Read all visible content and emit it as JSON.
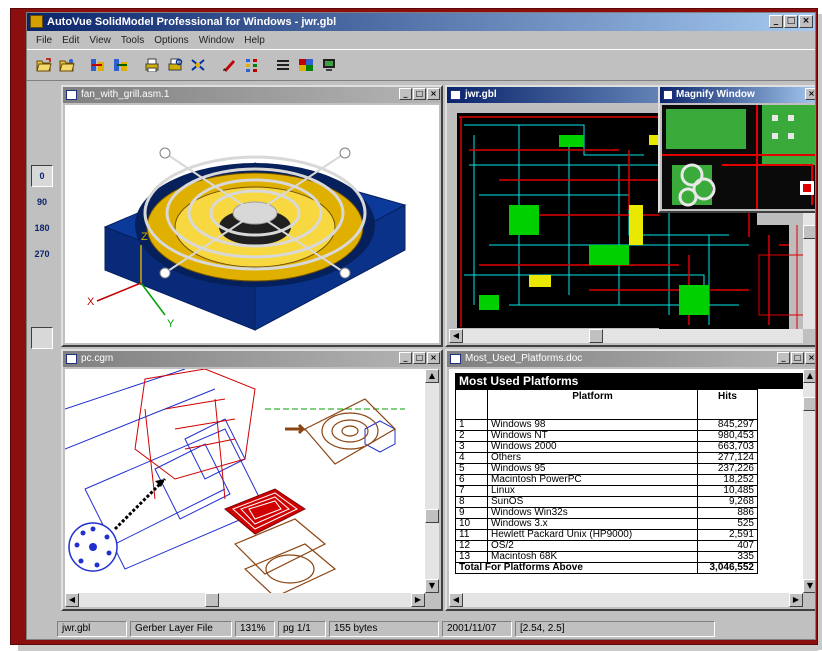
{
  "app": {
    "title": "AutoVue SolidModel Professional for Windows - jwr.gbl"
  },
  "menu": [
    "File",
    "Edit",
    "View",
    "Tools",
    "Options",
    "Window",
    "Help"
  ],
  "toolbar_icons": [
    "open-folder-icon",
    "open-folder-alt-icon",
    "compare-icon",
    "compare-alt-icon",
    "print-icon",
    "print-preview-icon",
    "properties-icon",
    "markup-pen-icon",
    "layers-icon",
    "list-icon",
    "tile-windows-icon",
    "monitor-icon"
  ],
  "left_tools": [
    {
      "name": "rotate-x-icon",
      "label": "",
      "state": "disabled"
    },
    {
      "name": "rotate-y-icon",
      "label": "",
      "state": "disabled"
    },
    {
      "name": "rotate-z-icon",
      "label": "",
      "state": "disabled"
    },
    {
      "name": "rotate-0-icon",
      "label": "0",
      "state": "active"
    },
    {
      "name": "rotate-90-icon",
      "label": "90",
      "state": "normal"
    },
    {
      "name": "rotate-180-icon",
      "label": "180",
      "state": "normal"
    },
    {
      "name": "rotate-270-icon",
      "label": "270",
      "state": "normal"
    },
    {
      "name": "navigate-icon",
      "label": "",
      "state": "normal"
    },
    {
      "name": "zoom-window-icon",
      "label": "",
      "state": "normal"
    },
    {
      "name": "zoom-fit-icon",
      "label": "",
      "state": "active"
    }
  ],
  "windows": {
    "fan": {
      "title": "fan_with_grill.asm.1",
      "axes": {
        "x": "X",
        "y": "Y",
        "z": "Z"
      }
    },
    "pcb": {
      "title": "jwr.gbl"
    },
    "magnify": {
      "title": "Magnify Window"
    },
    "cgm": {
      "title": "pc.cgm"
    },
    "doc": {
      "title": "Most_Used_Platforms.doc"
    }
  },
  "document": {
    "heading": "Most Used Platforms",
    "columns": [
      "",
      "Platform",
      "Hits"
    ],
    "rows": [
      {
        "idx": "1",
        "platform": "Windows 98",
        "hits": "845,297"
      },
      {
        "idx": "2",
        "platform": "Windows NT",
        "hits": "980,453"
      },
      {
        "idx": "3",
        "platform": "Windows 2000",
        "hits": "663,703"
      },
      {
        "idx": "4",
        "platform": "Others",
        "hits": "277,124"
      },
      {
        "idx": "5",
        "platform": "Windows 95",
        "hits": "237,226"
      },
      {
        "idx": "6",
        "platform": "Macintosh PowerPC",
        "hits": "18,252"
      },
      {
        "idx": "7",
        "platform": "Linux",
        "hits": "10,485"
      },
      {
        "idx": "8",
        "platform": "SunOS",
        "hits": "9,268"
      },
      {
        "idx": "9",
        "platform": "Windows Win32s",
        "hits": "886"
      },
      {
        "idx": "10",
        "platform": "Windows 3.x",
        "hits": "525"
      },
      {
        "idx": "11",
        "platform": "Hewlett Packard Unix (HP9000)",
        "hits": "2,591"
      },
      {
        "idx": "12",
        "platform": "OS/2",
        "hits": "407"
      },
      {
        "idx": "13",
        "platform": "Macintosh 68K",
        "hits": "335"
      }
    ],
    "total_label": "Total For Platforms Above",
    "total_value": "3,046,552"
  },
  "status": {
    "file": "jwr.gbl",
    "type": "Gerber Layer File",
    "zoom": "131%",
    "page": "pg 1/1",
    "size": "155 bytes",
    "date": "2001/11/07",
    "coords": "[2.54, 2.5]"
  },
  "colors": {
    "frame": "#8c0f0f",
    "active_title": "#0a246a",
    "pcb_bg": "#000000",
    "fan_body": "#0b3a9a",
    "fan_blade": "#e0b000"
  }
}
